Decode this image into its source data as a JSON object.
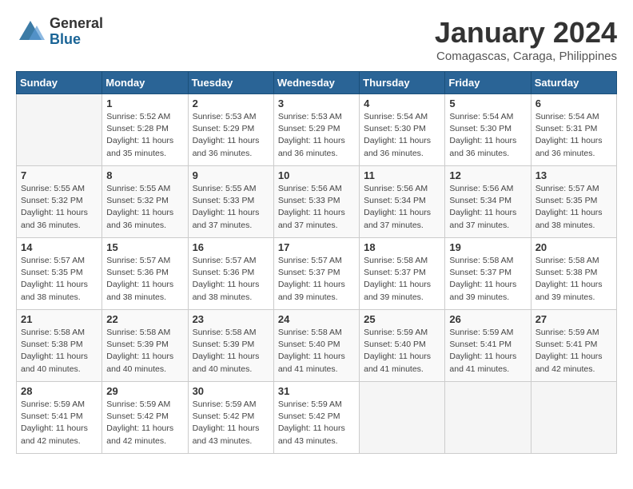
{
  "logo": {
    "general": "General",
    "blue": "Blue"
  },
  "title": "January 2024",
  "subtitle": "Comagascas, Caraga, Philippines",
  "weekdays": [
    "Sunday",
    "Monday",
    "Tuesday",
    "Wednesday",
    "Thursday",
    "Friday",
    "Saturday"
  ],
  "weeks": [
    [
      {
        "day": "",
        "info": ""
      },
      {
        "day": "1",
        "info": "Sunrise: 5:52 AM\nSunset: 5:28 PM\nDaylight: 11 hours\nand 35 minutes."
      },
      {
        "day": "2",
        "info": "Sunrise: 5:53 AM\nSunset: 5:29 PM\nDaylight: 11 hours\nand 36 minutes."
      },
      {
        "day": "3",
        "info": "Sunrise: 5:53 AM\nSunset: 5:29 PM\nDaylight: 11 hours\nand 36 minutes."
      },
      {
        "day": "4",
        "info": "Sunrise: 5:54 AM\nSunset: 5:30 PM\nDaylight: 11 hours\nand 36 minutes."
      },
      {
        "day": "5",
        "info": "Sunrise: 5:54 AM\nSunset: 5:30 PM\nDaylight: 11 hours\nand 36 minutes."
      },
      {
        "day": "6",
        "info": "Sunrise: 5:54 AM\nSunset: 5:31 PM\nDaylight: 11 hours\nand 36 minutes."
      }
    ],
    [
      {
        "day": "7",
        "info": "Sunrise: 5:55 AM\nSunset: 5:32 PM\nDaylight: 11 hours\nand 36 minutes."
      },
      {
        "day": "8",
        "info": "Sunrise: 5:55 AM\nSunset: 5:32 PM\nDaylight: 11 hours\nand 36 minutes."
      },
      {
        "day": "9",
        "info": "Sunrise: 5:55 AM\nSunset: 5:33 PM\nDaylight: 11 hours\nand 37 minutes."
      },
      {
        "day": "10",
        "info": "Sunrise: 5:56 AM\nSunset: 5:33 PM\nDaylight: 11 hours\nand 37 minutes."
      },
      {
        "day": "11",
        "info": "Sunrise: 5:56 AM\nSunset: 5:34 PM\nDaylight: 11 hours\nand 37 minutes."
      },
      {
        "day": "12",
        "info": "Sunrise: 5:56 AM\nSunset: 5:34 PM\nDaylight: 11 hours\nand 37 minutes."
      },
      {
        "day": "13",
        "info": "Sunrise: 5:57 AM\nSunset: 5:35 PM\nDaylight: 11 hours\nand 38 minutes."
      }
    ],
    [
      {
        "day": "14",
        "info": "Sunrise: 5:57 AM\nSunset: 5:35 PM\nDaylight: 11 hours\nand 38 minutes."
      },
      {
        "day": "15",
        "info": "Sunrise: 5:57 AM\nSunset: 5:36 PM\nDaylight: 11 hours\nand 38 minutes."
      },
      {
        "day": "16",
        "info": "Sunrise: 5:57 AM\nSunset: 5:36 PM\nDaylight: 11 hours\nand 38 minutes."
      },
      {
        "day": "17",
        "info": "Sunrise: 5:57 AM\nSunset: 5:37 PM\nDaylight: 11 hours\nand 39 minutes."
      },
      {
        "day": "18",
        "info": "Sunrise: 5:58 AM\nSunset: 5:37 PM\nDaylight: 11 hours\nand 39 minutes."
      },
      {
        "day": "19",
        "info": "Sunrise: 5:58 AM\nSunset: 5:37 PM\nDaylight: 11 hours\nand 39 minutes."
      },
      {
        "day": "20",
        "info": "Sunrise: 5:58 AM\nSunset: 5:38 PM\nDaylight: 11 hours\nand 39 minutes."
      }
    ],
    [
      {
        "day": "21",
        "info": "Sunrise: 5:58 AM\nSunset: 5:38 PM\nDaylight: 11 hours\nand 40 minutes."
      },
      {
        "day": "22",
        "info": "Sunrise: 5:58 AM\nSunset: 5:39 PM\nDaylight: 11 hours\nand 40 minutes."
      },
      {
        "day": "23",
        "info": "Sunrise: 5:58 AM\nSunset: 5:39 PM\nDaylight: 11 hours\nand 40 minutes."
      },
      {
        "day": "24",
        "info": "Sunrise: 5:58 AM\nSunset: 5:40 PM\nDaylight: 11 hours\nand 41 minutes."
      },
      {
        "day": "25",
        "info": "Sunrise: 5:59 AM\nSunset: 5:40 PM\nDaylight: 11 hours\nand 41 minutes."
      },
      {
        "day": "26",
        "info": "Sunrise: 5:59 AM\nSunset: 5:41 PM\nDaylight: 11 hours\nand 41 minutes."
      },
      {
        "day": "27",
        "info": "Sunrise: 5:59 AM\nSunset: 5:41 PM\nDaylight: 11 hours\nand 42 minutes."
      }
    ],
    [
      {
        "day": "28",
        "info": "Sunrise: 5:59 AM\nSunset: 5:41 PM\nDaylight: 11 hours\nand 42 minutes."
      },
      {
        "day": "29",
        "info": "Sunrise: 5:59 AM\nSunset: 5:42 PM\nDaylight: 11 hours\nand 42 minutes."
      },
      {
        "day": "30",
        "info": "Sunrise: 5:59 AM\nSunset: 5:42 PM\nDaylight: 11 hours\nand 43 minutes."
      },
      {
        "day": "31",
        "info": "Sunrise: 5:59 AM\nSunset: 5:42 PM\nDaylight: 11 hours\nand 43 minutes."
      },
      {
        "day": "",
        "info": ""
      },
      {
        "day": "",
        "info": ""
      },
      {
        "day": "",
        "info": ""
      }
    ]
  ]
}
